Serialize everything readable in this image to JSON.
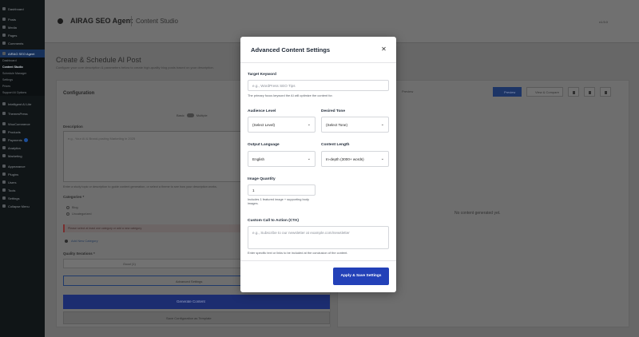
{
  "sidebar": {
    "items": [
      {
        "label": "Dashboard"
      },
      {
        "label": "Posts"
      },
      {
        "label": "Media"
      },
      {
        "label": "Pages"
      },
      {
        "label": "Comments"
      },
      {
        "label": "AIRAG SEO Agent"
      }
    ],
    "subitems": [
      "Dashboard",
      "Content Studio",
      "Schedule Manager",
      "Settings",
      "Prices",
      "Support AI Options"
    ],
    "items_after": [
      {
        "label": "Intelligent AI Lite"
      },
      {
        "label": "ThemesPress"
      },
      {
        "label": "WooCommerce"
      },
      {
        "label": "Products"
      },
      {
        "label": "Payments"
      },
      {
        "label": "Analytics"
      },
      {
        "label": "Marketing"
      },
      {
        "label": "Appearance"
      },
      {
        "label": "Plugins"
      },
      {
        "label": "Users"
      },
      {
        "label": "Tools"
      },
      {
        "label": "Settings"
      },
      {
        "label": "Collapse Menu"
      }
    ]
  },
  "header": {
    "app_title": "AIRAG SEO Agent",
    "subtitle": "Content Studio",
    "version": "v1.5.0"
  },
  "main": {
    "heading": "Create & Schedule AI Post",
    "description": "Configure your core description & parameters below to create high-quality blog posts based on your description.",
    "config": {
      "title": "Configuration",
      "toggle_left": "Basic",
      "toggle_right": "Multiple",
      "description_label": "Description",
      "description_placeholder": "e.g., Your AI & Brand-posting Marketing in 2025",
      "helper": "Enter a study topic or description to guide content generation, or select a theme to see how your description works.",
      "categories_label": "Categories *",
      "categories": [
        "Blog",
        "Uncategorized"
      ],
      "error": "Please select at least one category or add a new category",
      "add_category": "Add New Category",
      "quality_label": "Quality Iterations *",
      "quality_value": "Good (1)",
      "advanced_button": "Advanced Settings",
      "generate_button": "Generate Content",
      "save_template": "Save Configuration as Template"
    },
    "preview": {
      "tab_label": "Preview",
      "preview_button": "Preview",
      "code_button": "View & Compare",
      "empty_message": "No content generated yet."
    }
  },
  "modal": {
    "title": "Advanced Content Settings",
    "close_icon": "close-icon",
    "target_keyword": {
      "label": "Target Keyword",
      "placeholder": "e.g., WordPress SEO Tips",
      "help": "The primary focus keyword the AI will optimize the content for."
    },
    "audience_level": {
      "label": "Audience Level",
      "value": "(Select Level)"
    },
    "desired_tone": {
      "label": "Desired Tone",
      "value": "(Select Tone)"
    },
    "output_language": {
      "label": "Output Language",
      "value": "English"
    },
    "content_length": {
      "label": "Content Length",
      "value": "In-depth (3000+ words)"
    },
    "image_quantity": {
      "label": "Image Quantity",
      "value": "1",
      "help": "Includes 1 featured image + supporting body images."
    },
    "cta": {
      "label": "Custom Call to Action (CTA)",
      "placeholder": "e.g., Subscribe to our newsletter at example.com/newsletter",
      "help": "Enter specific text or links to be included at the conclusion of the content."
    },
    "apply_button": "Apply & Save Settings"
  },
  "colors": {
    "accent": "#2341b8",
    "sidebar_bg": "#101517",
    "sidebar_active": "#17315a",
    "overlay": "#676767"
  }
}
